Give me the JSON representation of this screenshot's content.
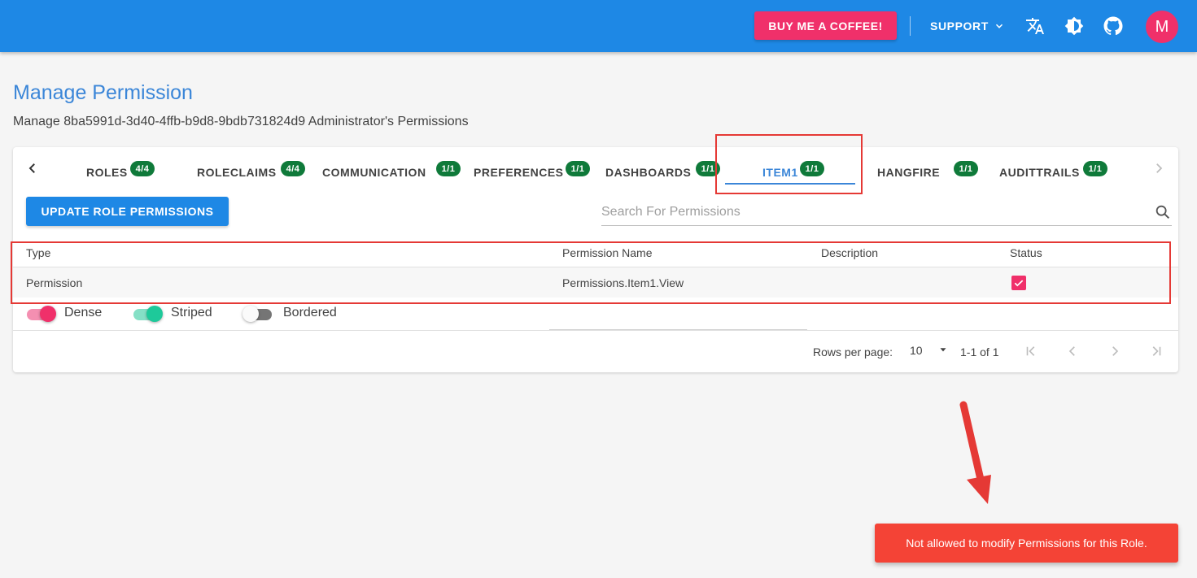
{
  "appbar": {
    "coffee_label": "BUY ME A COFFEE!",
    "support_label": "SUPPORT",
    "avatar_initial": "M",
    "icons": [
      "translate-icon",
      "brightness-icon",
      "github-icon"
    ],
    "color": "#1e88e5"
  },
  "page": {
    "title": "Manage Permission",
    "subtitle": "Manage 8ba5991d-3d40-4ffb-b9d8-9bdb731824d9 Administrator's Permissions"
  },
  "tabs": [
    {
      "label": "ROLES",
      "badge": "4/4"
    },
    {
      "label": "ROLECLAIMS",
      "badge": "4/4"
    },
    {
      "label": "COMMUNICATION",
      "badge": "1/1"
    },
    {
      "label": "PREFERENCES",
      "badge": "1/1"
    },
    {
      "label": "DASHBOARDS",
      "badge": "1/1"
    },
    {
      "label": "ITEM1",
      "badge": "1/1",
      "active": true
    },
    {
      "label": "HANGFIRE",
      "badge": "1/1"
    },
    {
      "label": "AUDITTRAILS",
      "badge": "1/1"
    }
  ],
  "toolbar": {
    "update_label": "UPDATE ROLE PERMISSIONS",
    "search_placeholder": "Search For Permissions"
  },
  "table": {
    "columns": [
      "Type",
      "Permission Name",
      "Description",
      "Status"
    ],
    "rows": [
      {
        "type": "Permission",
        "name": "Permissions.Item1.View",
        "description": "",
        "status": true
      }
    ]
  },
  "switches": [
    {
      "label": "Dense",
      "on": true,
      "color": "#f0306a"
    },
    {
      "label": "Striped",
      "on": true,
      "color": "#1ec99a"
    },
    {
      "label": "Bordered",
      "on": false,
      "color": "#757575"
    }
  ],
  "pagination": {
    "rows_per_page_label": "Rows per page:",
    "rows_per_page_value": "10",
    "range": "1-1 of 1"
  },
  "snackbar": {
    "message": "Not allowed to modify Permissions for this Role.",
    "color": "#f44336"
  }
}
